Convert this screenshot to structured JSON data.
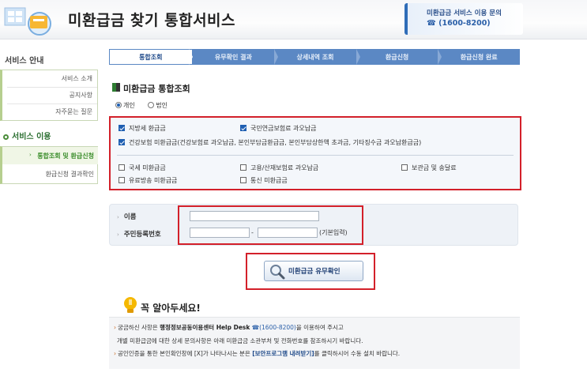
{
  "header": {
    "title": "미환급금 찾기 통합서비스",
    "help_title": "미환급금 서비스 이용 문의",
    "help_phone": "☎ (1600-8200)"
  },
  "sidebar": {
    "guide_title": "서비스 안내",
    "guide_items": [
      "서비스 소개",
      "공지사항",
      "자주묻는 질문"
    ],
    "use_title": "서비스 이용",
    "use_items": [
      "통합조회 및 환급신청",
      "환급신청 결과확인"
    ]
  },
  "steps": [
    "통합조회",
    "유무확인 결과",
    "상세내역 조회",
    "환급신청",
    "환급신청 완료"
  ],
  "section_title": "미환급금 통합조회",
  "person_type": {
    "options": [
      "개인",
      "법인"
    ],
    "selected": "개인"
  },
  "checkboxes": {
    "row1": [
      {
        "label": "지방세 환급금",
        "checked": true
      },
      {
        "label": "국민연금보험료 과오납금",
        "checked": true
      }
    ],
    "row2": [
      {
        "label": "건강보험 미환급금(건강보험료 과오납금, 본인부담금환급금, 본인부담상한액 초과금, 기타징수금 과오납환급금)",
        "checked": true
      }
    ],
    "row3": [
      {
        "label": "국세 미환급금",
        "checked": false
      },
      {
        "label": "고용/산재보험료 과오납금",
        "checked": false
      },
      {
        "label": "보관금 및 송달료",
        "checked": false
      }
    ],
    "row4": [
      {
        "label": "유료방송 미환급금",
        "checked": false
      },
      {
        "label": "통신 미환급금",
        "checked": false
      }
    ]
  },
  "form": {
    "name_label": "이름",
    "rrn_label": "주민등록번호",
    "name_value": "",
    "rrn_front": "",
    "rrn_back": "",
    "rrn_hint": "(기본입력)"
  },
  "check_button": {
    "label": "미환급금 유무확인"
  },
  "notice": {
    "title": "꼭 알아두세요!",
    "line1_a": "궁금하신 사항은 ",
    "line1_b": "행정정보공동이용센터 Help Desk",
    "line1_c": "(1600-8200)",
    "line1_d": "을 이용하여 주시고",
    "line2": "개별 미환급금에 대한 상세 문의사항은 아래 미환급금 소관부처 및 전화번호를 참조하시기 바랍니다.",
    "line3_a": "공인인증을 통한 본인확인창에 [X]가 나타나시는 분은 ",
    "line3_b": "[보안프로그램 내려받기]",
    "line3_c": "를 클릭하시어 수동 설치 바랍니다."
  },
  "colors": {
    "accent_red": "#d3202a",
    "step_blue": "#5b88c4",
    "sidebar_green": "#3a8d2b"
  }
}
